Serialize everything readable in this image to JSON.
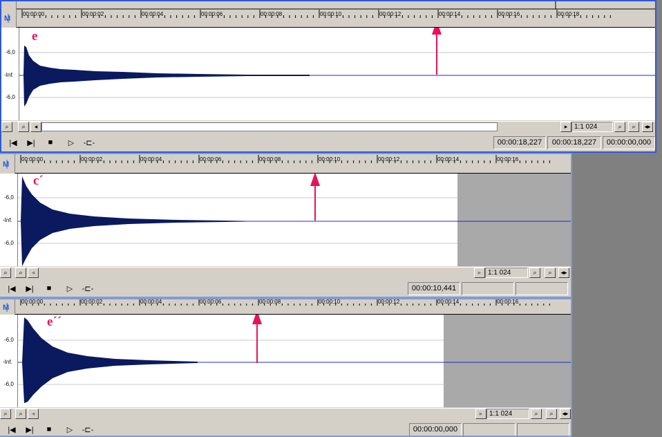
{
  "colors": {
    "waveform": "#0b1a5e",
    "marker": "#e8125a",
    "baseline": "#1c2cc7"
  },
  "ruler_ticks": [
    "00:00:00",
    "00:00:02",
    "00:00:04",
    "00:00:06",
    "00:00:08",
    "00:00:10",
    "00:00:12",
    "00:00:14",
    "00:00:16",
    "00:00:18"
  ],
  "db_labels": [
    "-6,0",
    "-Inf.",
    "-6,0"
  ],
  "icons": {
    "zoom_in": "zoom-in-icon",
    "zoom_out": "zoom-out-icon",
    "go_start": "go-to-start-icon",
    "go_end": "go-to-end-icon",
    "stop": "stop-icon",
    "play": "play-icon",
    "scrub": "scrub-icon"
  },
  "windows": [
    {
      "marker": "e",
      "zoom": "1:1 024",
      "times": [
        "00:00:18,227",
        "00:00:18,227",
        "00:00:00,000"
      ],
      "arrow_time_s": 14.0
    },
    {
      "marker": "c´",
      "zoom": "1:1 024",
      "times": [
        "00:00:10,441",
        "",
        ""
      ],
      "arrow_time_s": 10.0
    },
    {
      "marker": "e´´",
      "zoom": "1:1 024",
      "times": [
        "00:00:00,000",
        "",
        ""
      ],
      "arrow_time_s": 8.0
    }
  ]
}
